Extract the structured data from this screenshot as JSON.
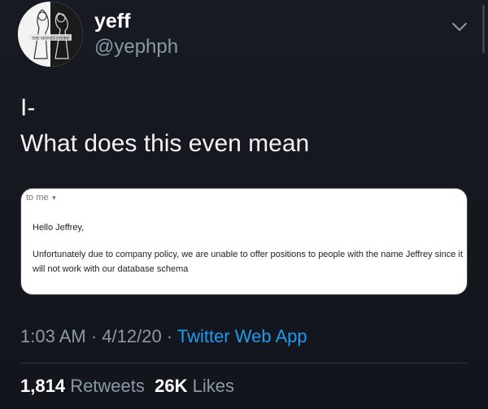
{
  "author": {
    "name": "yeff",
    "handle": "@yephph",
    "avatar_icon": "avatar-image",
    "avatar_caption": "THE MONEY STORE"
  },
  "header": {
    "menu_icon": "chevron-down-icon"
  },
  "tweet": {
    "line1": "I-",
    "line2": "What does this even mean"
  },
  "email": {
    "recipient": "to me",
    "greeting": "Hello Jeffrey,",
    "body_line1": "Unfortunately due to company policy, we are unable to offer positions to people with the name Jeffrey since it",
    "body_line2": "will not work with our database schema"
  },
  "meta": {
    "time": "1:03 AM",
    "separator": " · ",
    "date": "4/12/20",
    "source": "Twitter Web App"
  },
  "stats": {
    "retweets_count": "1,814",
    "retweets_label": "Retweets",
    "likes_count": "26K",
    "likes_label": "Likes"
  },
  "colors": {
    "background": "#15181f",
    "primary_text": "#ffffff",
    "secondary_text": "#8b98a5",
    "link": "#1d9bf0"
  }
}
